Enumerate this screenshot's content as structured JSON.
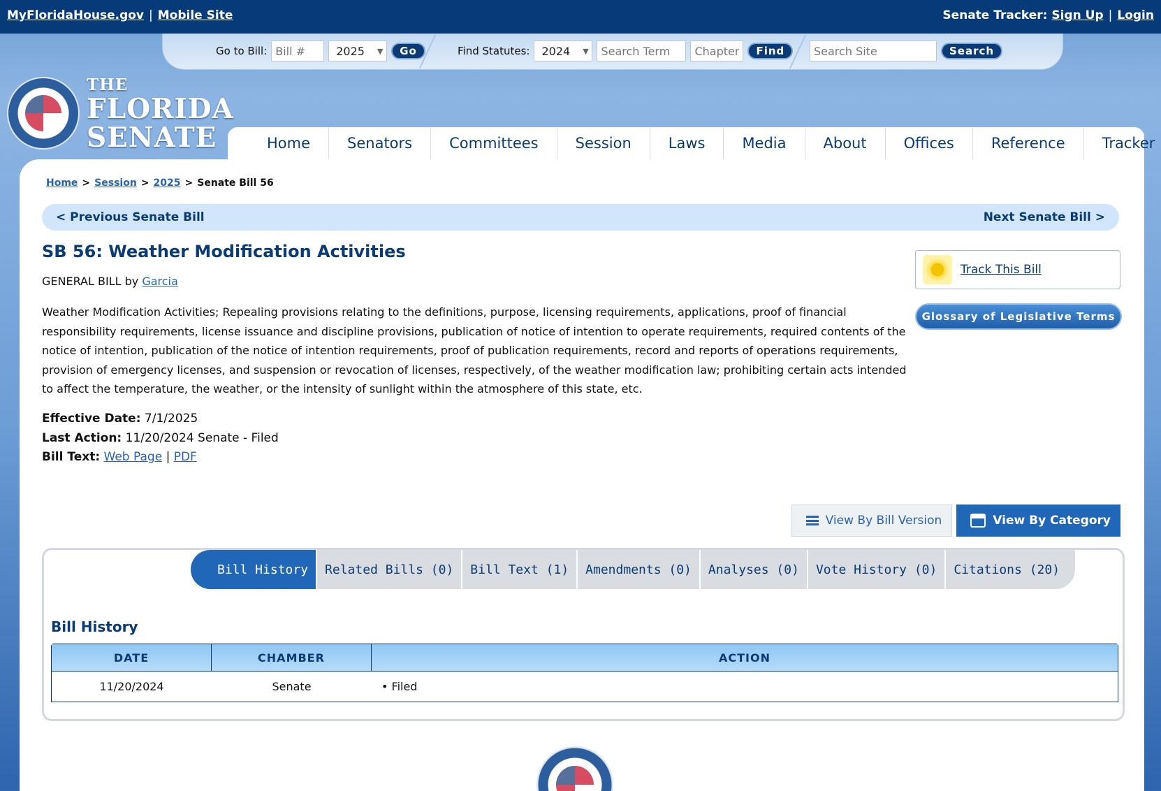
{
  "topbar": {
    "house_link": "MyFloridaHouse.gov",
    "mobile_link": "Mobile Site",
    "tracker_label": "Senate Tracker:",
    "signup_link": "Sign Up",
    "login_link": "Login",
    "sep": "|"
  },
  "search": {
    "goto_label": "Go to Bill:",
    "bill_placeholder": "Bill #",
    "bill_year": "2025",
    "go_button": "Go",
    "statutes_label": "Find Statutes:",
    "statute_year": "2024",
    "term_placeholder": "Search Term",
    "chapter_placeholder": "Chapter",
    "find_button": "Find",
    "site_placeholder": "Search Site",
    "search_button": "Search"
  },
  "logo": {
    "the": "THE",
    "florida": "FLORIDA",
    "senate": "SENATE"
  },
  "nav": {
    "items": [
      "Home",
      "Senators",
      "Committees",
      "Session",
      "Laws",
      "Media",
      "About",
      "Offices",
      "Reference",
      "Tracker"
    ]
  },
  "breadcrumb": {
    "home": "Home",
    "session": "Session",
    "year": "2025",
    "gt": ">",
    "current": "Senate Bill 56"
  },
  "prevnext": {
    "prev": "< Previous Senate Bill",
    "next": "Next Senate Bill >"
  },
  "bill": {
    "title": "SB 56: Weather Modification Activities",
    "type": "GENERAL BILL by",
    "sponsor": "Garcia",
    "summary": "Weather Modification Activities; Repealing provisions relating to the definitions, purpose, licensing requirements, applications, proof of financial responsibility requirements, license issuance and discipline provisions, publication of notice of intention to operate requirements, required contents of the notice of intention, publication of the notice of intention requirements, proof of publication requirements, record and reports of operations requirements, provision of emergency licenses, and suspension or revocation of licenses, respectively, of the weather modification law; prohibiting certain acts intended to affect the temperature, the weather, or the intensity of sunlight within the atmosphere of this state, etc.",
    "effective_label": "Effective Date:",
    "effective_value": "7/1/2025",
    "last_action_label": "Last Action:",
    "last_action_value": "11/20/2024 Senate - Filed",
    "bill_text_label": "Bill Text:",
    "web_page": "Web Page",
    "pdf": "PDF",
    "sep": "|"
  },
  "sidebar": {
    "track": "Track This Bill",
    "glossary": "Glossary of Legislative Terms"
  },
  "view": {
    "by_version": "View By Bill Version",
    "by_category": "View By Category"
  },
  "tabs": [
    "Bill History",
    "Related Bills (0)",
    "Bill Text (1)",
    "Amendments (0)",
    "Analyses (0)",
    "Vote History (0)",
    "Citations (20)"
  ],
  "history": {
    "title": "Bill History",
    "columns": [
      "DATE",
      "CHAMBER",
      "ACTION"
    ],
    "rows": [
      {
        "date": "11/20/2024",
        "chamber": "Senate",
        "action": "• Filed"
      }
    ]
  },
  "colors": {
    "topbar": "#073a78",
    "accent": "#2167b8",
    "navy_text": "#0b3b74",
    "link": "#2a64b0"
  }
}
